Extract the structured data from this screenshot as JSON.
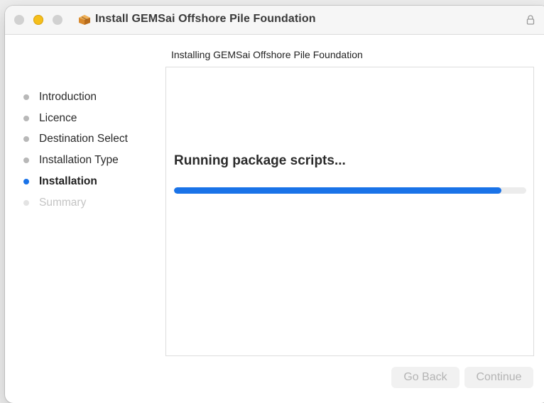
{
  "window": {
    "title": "Install GEMSai Offshore Pile Foundation",
    "icon": "package-box-icon"
  },
  "content": {
    "heading": "Installing GEMSai Offshore Pile Foundation",
    "status_text": "Running package scripts...",
    "progress_fraction": 0.93
  },
  "steps": [
    {
      "label": "Introduction",
      "state": "done"
    },
    {
      "label": "Licence",
      "state": "done"
    },
    {
      "label": "Destination Select",
      "state": "done"
    },
    {
      "label": "Installation Type",
      "state": "done"
    },
    {
      "label": "Installation",
      "state": "active"
    },
    {
      "label": "Summary",
      "state": "pending"
    }
  ],
  "buttons": {
    "go_back": "Go Back",
    "continue": "Continue"
  },
  "colors": {
    "accent": "#1a73e8",
    "minimize": "#f5bf1b"
  }
}
